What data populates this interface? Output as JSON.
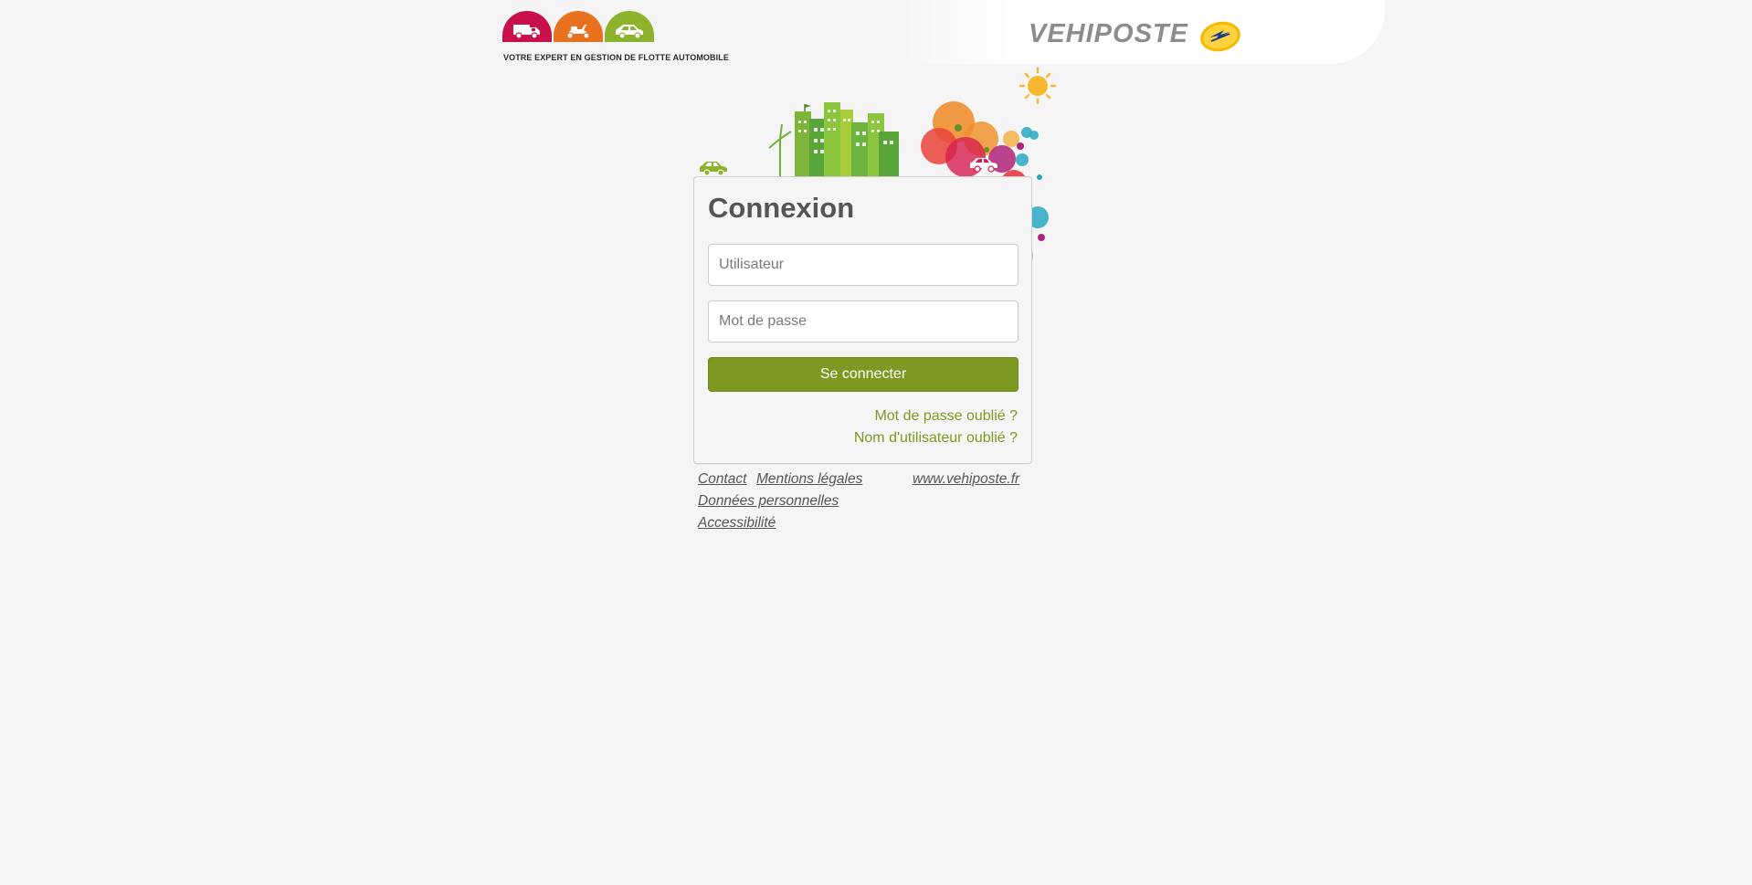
{
  "header": {
    "tagline": "VOTRE EXPERT EN GESTION DE FLOTTE AUTOMOBILE",
    "logo_text": "VEHIPOSTE",
    "brand_icons": [
      {
        "name": "truck-icon",
        "color": "#c8114a"
      },
      {
        "name": "scooter-icon",
        "color": "#e8711d"
      },
      {
        "name": "car-icon",
        "color": "#8db32d"
      }
    ],
    "emblem": "la-poste-emblem-icon"
  },
  "login": {
    "title": "Connexion",
    "username_placeholder": "Utilisateur",
    "username_value": "",
    "password_placeholder": "Mot de passe",
    "password_value": "",
    "submit_label": "Se connecter",
    "forgot_password": "Mot de passe oublié ?",
    "forgot_username": "Nom d'utilisateur oublié ?"
  },
  "footer": {
    "contact": "Contact",
    "mentions": "Mentions légales",
    "website": "www.vehiposte.fr",
    "donnees": "Données personnelles",
    "accessibilite": "Accessibilité"
  },
  "colors": {
    "accent": "#7c9a22",
    "background": "#f5f5f5",
    "text": "#555555"
  }
}
